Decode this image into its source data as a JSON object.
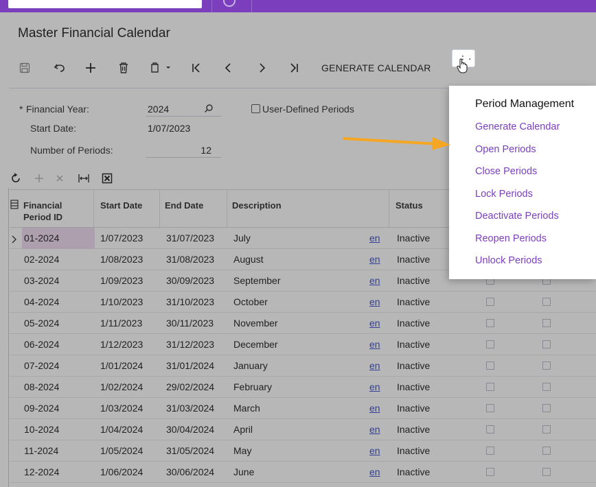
{
  "page": {
    "title": "Master Financial Calendar"
  },
  "toolbar": {
    "generate_calendar": "GENERATE CALENDAR"
  },
  "form": {
    "financial_year_label": "Financial Year:",
    "financial_year_required": "*",
    "financial_year_value": "2024",
    "start_date_label": "Start Date:",
    "start_date_value": "1/07/2023",
    "periods_label": "Number of Periods:",
    "periods_value": "12",
    "user_defined_label": "User-Defined Periods"
  },
  "table": {
    "headers": {
      "period_id": "Financial Period ID",
      "start": "Start Date",
      "end": "End Date",
      "desc": "Description",
      "status": "Status"
    },
    "rows": [
      {
        "id": "01-2024",
        "start": "1/07/2023",
        "end": "31/07/2023",
        "desc": "July",
        "lang": "en",
        "status": "Inactive"
      },
      {
        "id": "02-2024",
        "start": "1/08/2023",
        "end": "31/08/2023",
        "desc": "August",
        "lang": "en",
        "status": "Inactive"
      },
      {
        "id": "03-2024",
        "start": "1/09/2023",
        "end": "30/09/2023",
        "desc": "September",
        "lang": "en",
        "status": "Inactive"
      },
      {
        "id": "04-2024",
        "start": "1/10/2023",
        "end": "31/10/2023",
        "desc": "October",
        "lang": "en",
        "status": "Inactive"
      },
      {
        "id": "05-2024",
        "start": "1/11/2023",
        "end": "30/11/2023",
        "desc": "November",
        "lang": "en",
        "status": "Inactive"
      },
      {
        "id": "06-2024",
        "start": "1/12/2023",
        "end": "31/12/2023",
        "desc": "December",
        "lang": "en",
        "status": "Inactive"
      },
      {
        "id": "07-2024",
        "start": "1/01/2024",
        "end": "31/01/2024",
        "desc": "January",
        "lang": "en",
        "status": "Inactive"
      },
      {
        "id": "08-2024",
        "start": "1/02/2024",
        "end": "29/02/2024",
        "desc": "February",
        "lang": "en",
        "status": "Inactive"
      },
      {
        "id": "09-2024",
        "start": "1/03/2024",
        "end": "31/03/2024",
        "desc": "March",
        "lang": "en",
        "status": "Inactive"
      },
      {
        "id": "10-2024",
        "start": "1/04/2024",
        "end": "30/04/2024",
        "desc": "April",
        "lang": "en",
        "status": "Inactive"
      },
      {
        "id": "11-2024",
        "start": "1/05/2024",
        "end": "31/05/2024",
        "desc": "May",
        "lang": "en",
        "status": "Inactive"
      },
      {
        "id": "12-2024",
        "start": "1/06/2024",
        "end": "30/06/2024",
        "desc": "June",
        "lang": "en",
        "status": "Inactive"
      }
    ]
  },
  "menu": {
    "heading": "Period Management",
    "items": [
      "Generate Calendar",
      "Open Periods",
      "Close Periods",
      "Lock Periods",
      "Deactivate Periods",
      "Reopen Periods",
      "Unlock Periods"
    ]
  },
  "colors": {
    "brand": "#7b3fbe",
    "accent_link": "#7b3fbe",
    "annotation_arrow": "#f5a623"
  }
}
